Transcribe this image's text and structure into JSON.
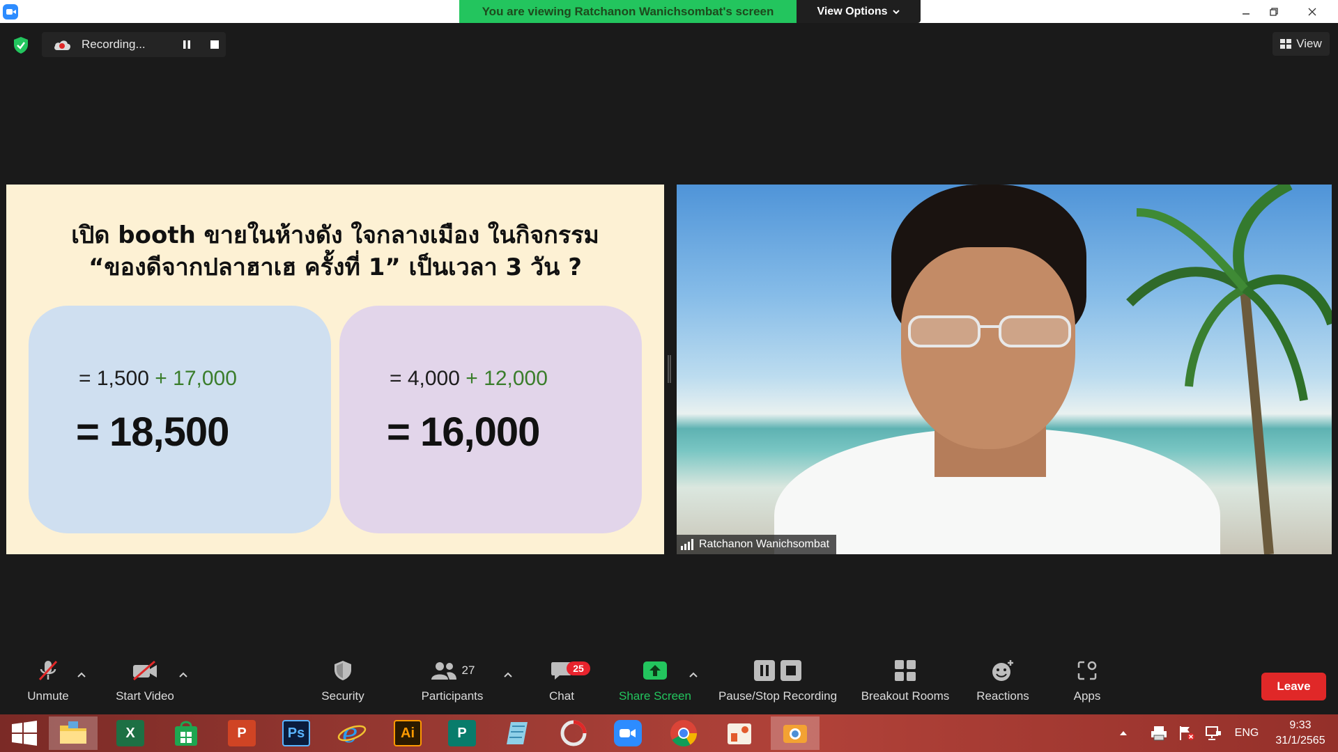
{
  "window": {
    "banner_text": "You are viewing Ratchanon Wanichsombat's screen",
    "view_options_label": "View Options",
    "minimize_icon": "minimize-icon",
    "restore_icon": "restore-icon",
    "close_icon": "close-icon"
  },
  "recording": {
    "status_text": "Recording...",
    "pause_icon": "pause-icon",
    "stop_icon": "stop-icon"
  },
  "view_button_label": "View",
  "slide": {
    "title_line1": "เปิด booth ขายในห้างดัง ใจกลางเมือง ในกิจกรรม",
    "title_line2": "“ของดีจากปลาฮาเฮ ครั้งที่ 1” เป็นเวลา 3 วัน ?",
    "left_box": {
      "eq_prefix": "= 1,500",
      "eq_plus": "+ 17,000",
      "total": "= 18,500"
    },
    "right_box": {
      "eq_prefix": "= 4,000",
      "eq_plus": "+ 12,000",
      "total": "= 16,000"
    },
    "colors": {
      "background": "#fdf1d4",
      "left_box": "#cfdff0",
      "right_box": "#e2d5ea",
      "plus_text": "#3a7d2b"
    }
  },
  "participant_video": {
    "name": "Ratchanon Wanichsombat",
    "signal_icon": "signal-bars-icon"
  },
  "toolbar": {
    "unmute_label": "Unmute",
    "start_video_label": "Start Video",
    "security_label": "Security",
    "participants_label": "Participants",
    "participants_count": "27",
    "chat_label": "Chat",
    "chat_badge": "25",
    "share_screen_label": "Share Screen",
    "pause_stop_recording_label": "Pause/Stop Recording",
    "breakout_rooms_label": "Breakout Rooms",
    "reactions_label": "Reactions",
    "apps_label": "Apps",
    "leave_label": "Leave",
    "colors": {
      "share_screen": "#23c55e",
      "leave": "#e02828",
      "badge": "#e8232d"
    }
  },
  "taskbar": {
    "apps": [
      {
        "name": "windows-start-icon"
      },
      {
        "name": "file-explorer-icon"
      },
      {
        "name": "excel-icon",
        "glyph": "X"
      },
      {
        "name": "store-icon"
      },
      {
        "name": "powerpoint-icon",
        "glyph": "P"
      },
      {
        "name": "photoshop-icon",
        "glyph": "Ps"
      },
      {
        "name": "internet-explorer-icon",
        "glyph": "e"
      },
      {
        "name": "illustrator-icon",
        "glyph": "Ai"
      },
      {
        "name": "publisher-icon",
        "glyph": "P"
      },
      {
        "name": "notepad-icon"
      },
      {
        "name": "hotocape-icon"
      },
      {
        "name": "zoom-icon"
      },
      {
        "name": "chrome-icon"
      },
      {
        "name": "photos-icon"
      },
      {
        "name": "screenshot-tool-icon"
      }
    ],
    "language": "ENG",
    "time": "9:33",
    "date": "31/1/2565"
  }
}
